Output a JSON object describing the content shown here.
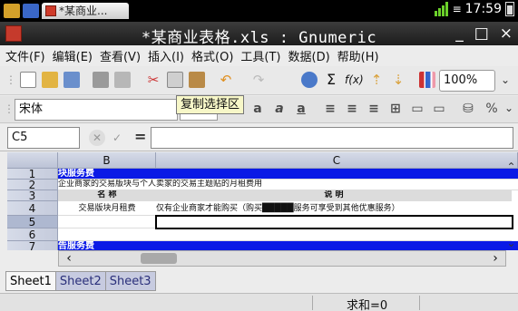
{
  "statusbar": {
    "tab_label": "*某商业...",
    "time": "17:59"
  },
  "window": {
    "title": "*某商业表格.xls : Gnumeric",
    "minimize": "_",
    "maximize": "□",
    "close": "×"
  },
  "menu": [
    "文件(F)",
    "编辑(E)",
    "查看(V)",
    "插入(I)",
    "格式(O)",
    "工具(T)",
    "数据(D)",
    "帮助(H)"
  ],
  "toolbar": {
    "zoom_value": "100%",
    "icons": [
      "new-file-icon",
      "open-folder-icon",
      "save-icon",
      "print-icon",
      "print-preview-icon",
      "cut-icon",
      "copy-icon",
      "paste-icon",
      "undo-icon",
      "redo-icon",
      "hyperlink-icon",
      "sum-icon",
      "function-icon",
      "sort-ascending-icon",
      "sort-descending-icon",
      "chart-icon"
    ]
  },
  "format_bar": {
    "font_name": "宋体",
    "tooltip": "复制选择区"
  },
  "formula_bar": {
    "cell_ref": "C5",
    "equals": "="
  },
  "grid": {
    "columns": [
      "B",
      "C"
    ],
    "rows": [
      {
        "num": "1",
        "b": "块服务费",
        "c": "",
        "style": "blue"
      },
      {
        "num": "2",
        "b": "企业商家的交易版块与个人卖家的交易主题贴的月租费用",
        "c": "",
        "style": "plain"
      },
      {
        "num": "3",
        "b": "名 称",
        "c": "说 明",
        "style": "hdr"
      },
      {
        "num": "4",
        "b": "交易版块月租费",
        "c": "仅有企业商家才能购买（购买█████服务可享受到其他优惠服务）",
        "style": "plain"
      },
      {
        "num": "5",
        "b": "",
        "c": "",
        "style": "active"
      },
      {
        "num": "6",
        "b": "",
        "c": "",
        "style": "plain"
      },
      {
        "num": "7",
        "b": "告服务费",
        "c": "",
        "style": "blue"
      }
    ]
  },
  "sheets": [
    "Sheet1",
    "Sheet2",
    "Sheet3"
  ],
  "status": {
    "sum": "求和=0"
  }
}
